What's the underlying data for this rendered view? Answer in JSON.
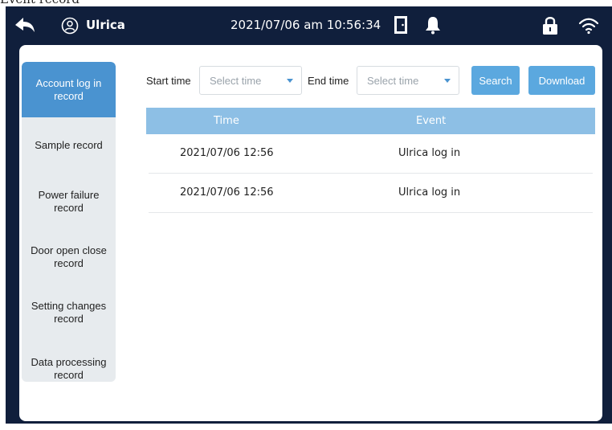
{
  "caption": "Event record",
  "topbar": {
    "back_icon": "back-arrow-icon",
    "user_icon": "user-circle-icon",
    "user_name": "Ulrica",
    "datetime": "2021/07/06 am 10:56:34",
    "door_icon": "door-icon",
    "bell_icon": "bell-icon",
    "lock_icon": "lock-icon",
    "wifi_icon": "wifi-icon"
  },
  "sidebar": {
    "items": [
      {
        "label": "Account log in record",
        "active": true
      },
      {
        "label": "Sample record",
        "active": false
      },
      {
        "label": "Power failure record",
        "active": false
      },
      {
        "label": "Door open close record",
        "active": false
      },
      {
        "label": "Setting changes record",
        "active": false
      },
      {
        "label": "Data processing record",
        "active": false
      }
    ]
  },
  "filters": {
    "start_label": "Start time",
    "start_placeholder": "Select time",
    "end_label": "End time",
    "end_placeholder": "Select time",
    "search_label": "Search",
    "download_label": "Download"
  },
  "table": {
    "columns": [
      "Time",
      "Event"
    ],
    "rows": [
      [
        "2021/07/06 12:56",
        "Ulrica log in"
      ],
      [
        "2021/07/06 12:56",
        "Ulrica log in"
      ]
    ]
  },
  "colors": {
    "frame": "#101f3c",
    "accent": "#4a93d0",
    "button": "#5ba8df",
    "table_header": "#8dbfe5",
    "sidebar_bg": "#e7ebee"
  }
}
